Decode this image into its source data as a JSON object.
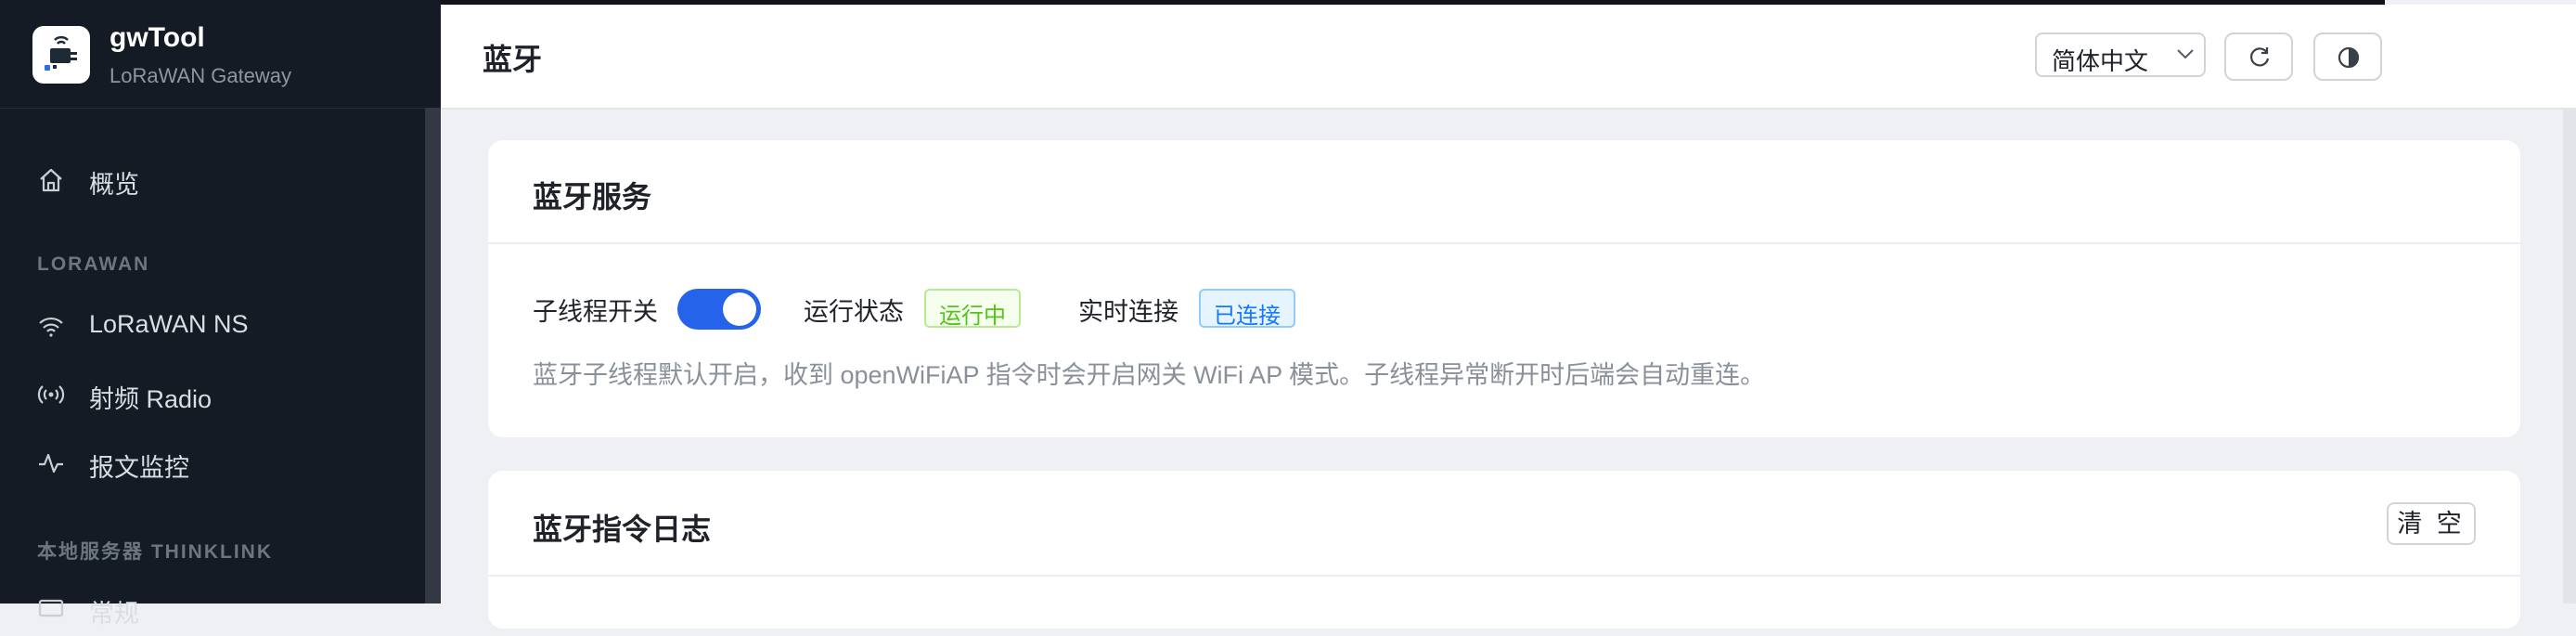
{
  "app": {
    "name": "gwTool",
    "subtitle": "LoRaWAN Gateway"
  },
  "sidebar": {
    "items": [
      {
        "label": "概览",
        "icon": "home-icon"
      },
      {
        "label": "LoRaWAN NS",
        "icon": "wifi-icon"
      },
      {
        "label": "射频 Radio",
        "icon": "radio-icon"
      },
      {
        "label": "报文监控",
        "icon": "activity-icon"
      },
      {
        "label": "常规",
        "icon": "monitor-icon"
      }
    ],
    "sections": [
      {
        "title": "LORAWAN"
      },
      {
        "title": "本地服务器 THINKLINK"
      }
    ]
  },
  "header": {
    "title": "蓝牙",
    "language": "简体中文",
    "refresh_icon": "refresh-icon",
    "theme_icon": "contrast-icon"
  },
  "bluetooth_service": {
    "title": "蓝牙服务",
    "thread_switch_label": "子线程开关",
    "thread_switch_on": true,
    "run_status_label": "运行状态",
    "run_status_value": "运行中",
    "realtime_label": "实时连接",
    "realtime_value": "已连接",
    "description": "蓝牙子线程默认开启，收到 openWiFiAP 指令时会开启网关 WiFi AP 模式。子线程异常断开时后端会自动重连。"
  },
  "command_log": {
    "title": "蓝牙指令日志",
    "clear_label": "清 空"
  },
  "colors": {
    "sidebar_bg": "#141b24",
    "accent": "#2563eb",
    "status_green": "#52c41a",
    "status_blue": "#1677ff"
  }
}
